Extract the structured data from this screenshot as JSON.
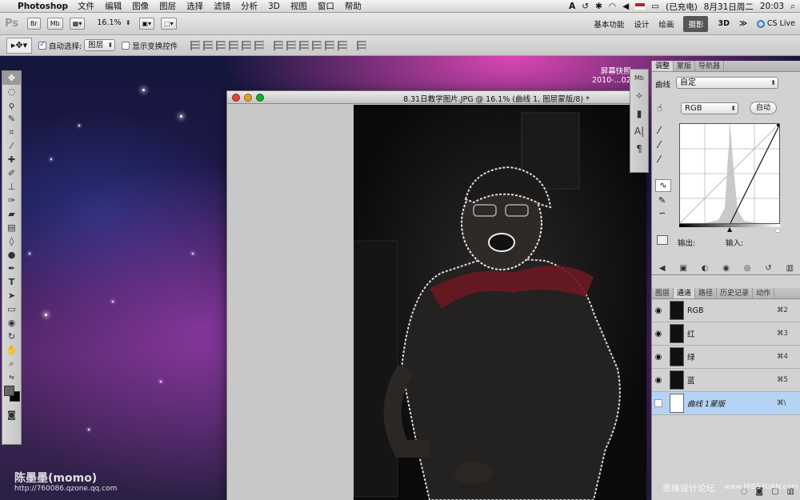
{
  "menubar": {
    "app_name": "Photoshop",
    "items": [
      "文件",
      "编辑",
      "图像",
      "图层",
      "选择",
      "滤镜",
      "分析",
      "3D",
      "视图",
      "窗口",
      "帮助"
    ],
    "battery": "(已充电)",
    "date": "8月31日周二",
    "time": "20:03"
  },
  "appbar": {
    "zoom": "16.1%",
    "workspaces": [
      "基本功能",
      "设计",
      "绘画",
      "摄影",
      "3D"
    ],
    "active_workspace": "摄影",
    "cs_live": "CS Live"
  },
  "options": {
    "auto_select_label": "自动选择:",
    "auto_select_value": "图层",
    "show_transform_label": "显示变换控件"
  },
  "desktop": {
    "screenshot_label": "屏幕快照",
    "screenshot_date": "2010-...02"
  },
  "document": {
    "title": "8.31日教学图片.JPG @ 16.1% (曲线 1, 图层蒙版/8) *"
  },
  "adjust_panel": {
    "tabs": [
      "调整",
      "蒙版",
      "导航器"
    ],
    "curve_label": "曲线",
    "preset_value": "自定",
    "channel_value": "RGB",
    "auto_button": "自动",
    "output_label": "输出:",
    "input_label": "输入:"
  },
  "layers_panel": {
    "tabs": [
      "图层",
      "通道",
      "路径",
      "历史记录",
      "动作"
    ],
    "channels": [
      {
        "name": "RGB",
        "shortcut": "⌘2"
      },
      {
        "name": "红",
        "shortcut": "⌘3"
      },
      {
        "name": "绿",
        "shortcut": "⌘4"
      },
      {
        "name": "蓝",
        "shortcut": "⌘5"
      },
      {
        "name": "曲线 1蒙版",
        "shortcut": "⌘\\"
      }
    ]
  },
  "watermarks": {
    "author": "陈墨墨(momo)",
    "url": "http://760086.qzone.qq.com",
    "site": "思缘设计论坛",
    "site_url": "www.MISSYUAN.com"
  }
}
